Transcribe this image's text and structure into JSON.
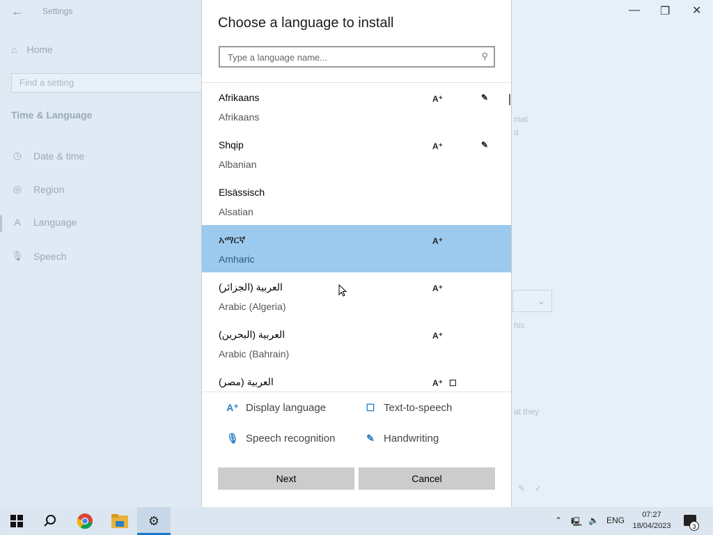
{
  "settings": {
    "title": "Settings",
    "home": "Home",
    "search_placeholder": "Find a setting",
    "section": "Time & Language",
    "nav": [
      {
        "label": "Date & time",
        "icon": "clock-icon"
      },
      {
        "label": "Region",
        "icon": "globe-icon"
      },
      {
        "label": "Language",
        "icon": "language-icon"
      },
      {
        "label": "Speech",
        "icon": "microphone-icon"
      }
    ],
    "bg_fragments": [
      "mat",
      "d",
      "his",
      "at they"
    ]
  },
  "dialog": {
    "title": "Choose a language to install",
    "search_placeholder": "Type a language name...",
    "languages": [
      {
        "native": "Afrikaans",
        "english": "Afrikaans",
        "display": true,
        "tts": false,
        "handwriting": true
      },
      {
        "native": "Shqip",
        "english": "Albanian",
        "display": true,
        "tts": false,
        "handwriting": true
      },
      {
        "native": "Elsässisch",
        "english": "Alsatian",
        "display": false,
        "tts": false,
        "handwriting": false
      },
      {
        "native": "አማርኛ",
        "english": "Amharic",
        "display": true,
        "tts": false,
        "handwriting": false,
        "selected": true
      },
      {
        "native": "العربية (الجزائر)",
        "english": "Arabic (Algeria)",
        "display": true,
        "tts": false,
        "handwriting": false
      },
      {
        "native": "العربية (البحرين)",
        "english": "Arabic (Bahrain)",
        "display": true,
        "tts": false,
        "handwriting": false
      },
      {
        "native": "العربية (مصر)",
        "english": "",
        "display": true,
        "tts": true,
        "handwriting": false
      }
    ],
    "legend": {
      "display_language": "Display language",
      "text_to_speech": "Text-to-speech",
      "speech_recognition": "Speech recognition",
      "handwriting": "Handwriting"
    },
    "next_label": "Next",
    "cancel_label": "Cancel"
  },
  "taskbar": {
    "language": "ENG",
    "time": "07:27",
    "date": "18/04/2023",
    "notification_count": "3"
  },
  "colors": {
    "selected_row": "#9cc9ee",
    "accent": "#1a74c7",
    "button": "#cccccc"
  }
}
